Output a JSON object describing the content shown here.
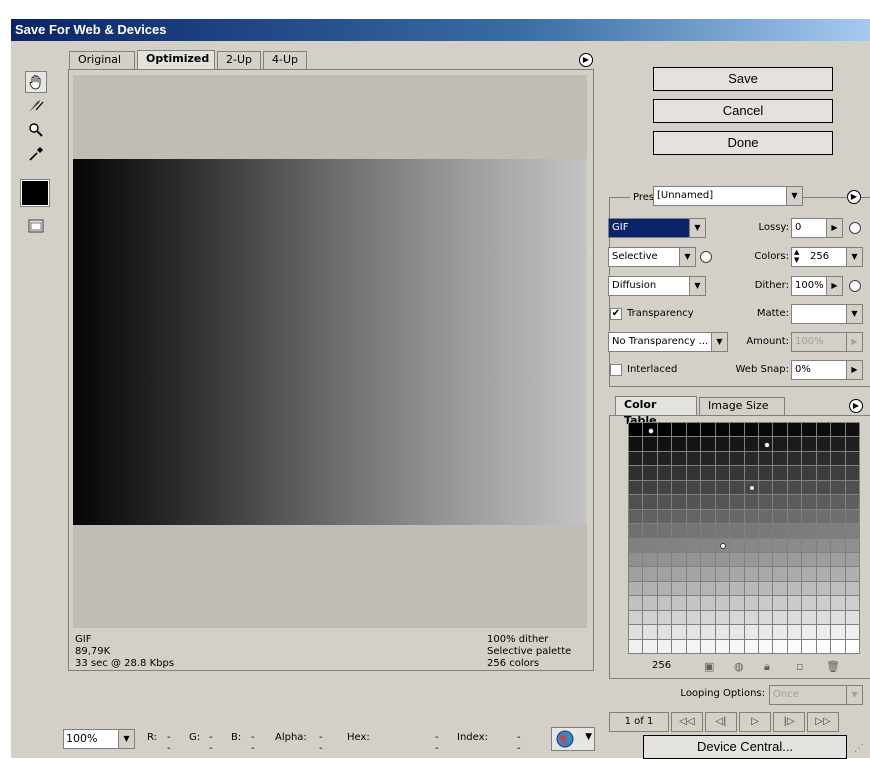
{
  "window": {
    "title": "Save For Web & Devices"
  },
  "tabs": [
    {
      "label": "Original",
      "active": false
    },
    {
      "label": "Optimized",
      "active": true
    },
    {
      "label": "2-Up",
      "active": false
    },
    {
      "label": "4-Up",
      "active": false
    }
  ],
  "tools": [
    "hand-icon",
    "slice-select-icon",
    "zoom-icon",
    "eyedropper-icon",
    "eyedropper-color-swatch",
    "toggle-slices-icon"
  ],
  "colors": {
    "eyedropper_color": "#000000",
    "title_bar": "#0a246a",
    "panel": "#d4d0c8"
  },
  "preview": {
    "format": "GIF",
    "size": "89,79K",
    "download_time": "33 sec @ 28.8 Kbps",
    "dither": "100% dither",
    "palette": "Selective palette",
    "colors": "256 colors"
  },
  "bottom_bar": {
    "zoom": "100%",
    "r_label": "R:",
    "r_value": "--",
    "g_label": "G:",
    "g_value": "--",
    "b_label": "B:",
    "b_value": "--",
    "alpha_label": "Alpha:",
    "alpha_value": "--",
    "hex_label": "Hex:",
    "hex_value": "--",
    "index_label": "Index:",
    "index_value": "--"
  },
  "buttons": {
    "save": "Save",
    "cancel": "Cancel",
    "done": "Done",
    "device_central": "Device Central..."
  },
  "settings": {
    "preset_label": "Preset:",
    "preset_value": "[Unnamed]",
    "format": "GIF",
    "reduction": "Selective",
    "dither_algorithm": "Diffusion",
    "transparency_label": "Transparency",
    "transparency_checked": true,
    "transparency_dither": "No Transparency ...",
    "interlaced_label": "Interlaced",
    "interlaced_checked": false,
    "lossy_label": "Lossy:",
    "lossy_value": "0",
    "colors_label": "Colors:",
    "colors_value": "256",
    "dither_label": "Dither:",
    "dither_value": "100%",
    "matte_label": "Matte:",
    "matte_value": "",
    "amount_label": "Amount:",
    "amount_value": "100%",
    "websnap_label": "Web Snap:",
    "websnap_value": "0%"
  },
  "color_table": {
    "tabs": [
      {
        "label": "Color Table",
        "active": true
      },
      {
        "label": "Image Size",
        "active": false
      }
    ],
    "count": "256",
    "marked_cells": [
      1,
      25,
      72,
      134
    ]
  },
  "animation": {
    "looping_label": "Looping Options:",
    "looping_value": "Once",
    "frame": "1 of 1"
  }
}
